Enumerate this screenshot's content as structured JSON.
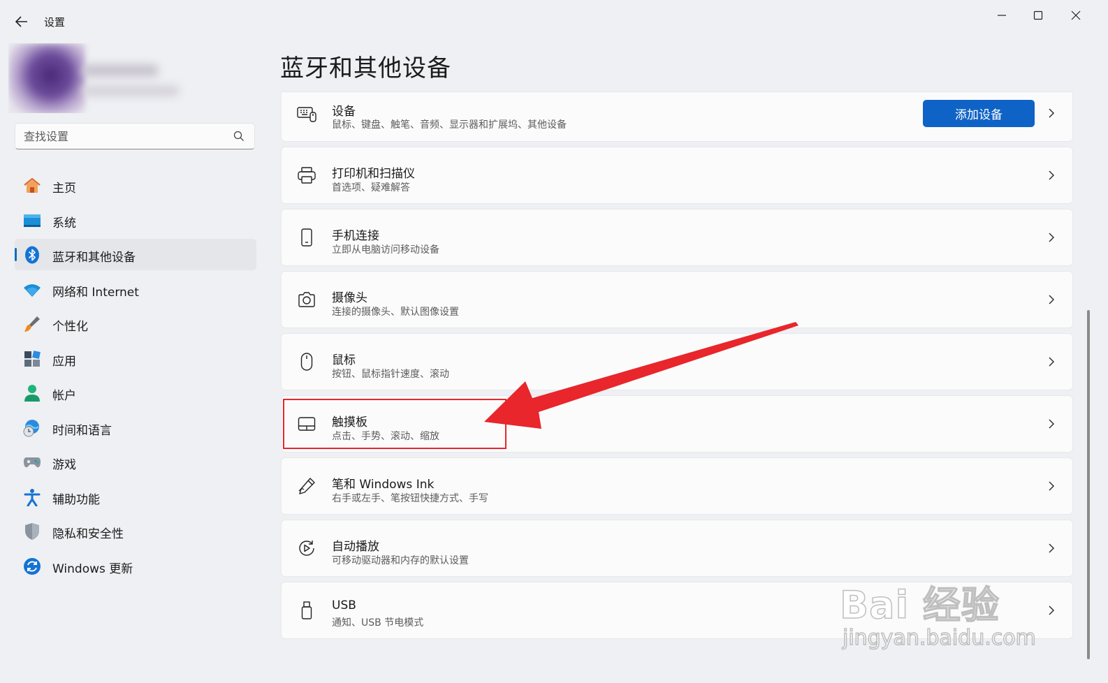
{
  "window": {
    "title": "设置",
    "controls": [
      "minimize-icon",
      "maximize-icon",
      "close-icon"
    ]
  },
  "sidebar": {
    "search": {
      "placeholder": "查找设置",
      "value": ""
    },
    "items": [
      {
        "label": "主页",
        "icon": "home-icon",
        "active": false
      },
      {
        "label": "系统",
        "icon": "system-icon",
        "active": false
      },
      {
        "label": "蓝牙和其他设备",
        "icon": "bluetooth-icon",
        "active": true
      },
      {
        "label": "网络和 Internet",
        "icon": "wifi-icon",
        "active": false
      },
      {
        "label": "个性化",
        "icon": "brush-icon",
        "active": false
      },
      {
        "label": "应用",
        "icon": "apps-icon",
        "active": false
      },
      {
        "label": "帐户",
        "icon": "account-icon",
        "active": false
      },
      {
        "label": "时间和语言",
        "icon": "globe-clock-icon",
        "active": false
      },
      {
        "label": "游戏",
        "icon": "gamepad-icon",
        "active": false
      },
      {
        "label": "辅助功能",
        "icon": "accessibility-icon",
        "active": false
      },
      {
        "label": "隐私和安全性",
        "icon": "shield-icon",
        "active": false
      },
      {
        "label": "Windows 更新",
        "icon": "update-icon",
        "active": false
      }
    ]
  },
  "main": {
    "title": "蓝牙和其他设备",
    "cards": [
      {
        "title": "设备",
        "desc": "鼠标、键盘、触笔、音频、显示器和扩展坞、其他设备",
        "icon": "devices-icon",
        "button": "添加设备"
      },
      {
        "title": "打印机和扫描仪",
        "desc": "首选项、疑难解答",
        "icon": "printer-icon"
      },
      {
        "title": "手机连接",
        "desc": "立即从电脑访问移动设备",
        "icon": "phone-icon"
      },
      {
        "title": "摄像头",
        "desc": "连接的摄像头、默认图像设置",
        "icon": "camera-icon"
      },
      {
        "title": "鼠标",
        "desc": "按钮、鼠标指针速度、滚动",
        "icon": "mouse-icon"
      },
      {
        "title": "触摸板",
        "desc": "点击、手势、滚动、缩放",
        "icon": "touchpad-icon"
      },
      {
        "title": "笔和 Windows Ink",
        "desc": "右手或左手、笔按钮快捷方式、手写",
        "icon": "pen-icon"
      },
      {
        "title": "自动播放",
        "desc": "可移动驱动器和内存的默认设置",
        "icon": "autoplay-icon"
      },
      {
        "title": "USB",
        "desc": "通知、USB 节电模式",
        "icon": "usb-icon"
      }
    ]
  },
  "annotation": {
    "highlighted_item": "触摸板",
    "color": "#e8262b"
  },
  "watermark": {
    "line1": "Bai 经验",
    "line2": "jingyan.baidu.com"
  },
  "colors": {
    "accent": "#0f63c6",
    "background": "#eef0f3",
    "card": "#fbfbfc"
  }
}
